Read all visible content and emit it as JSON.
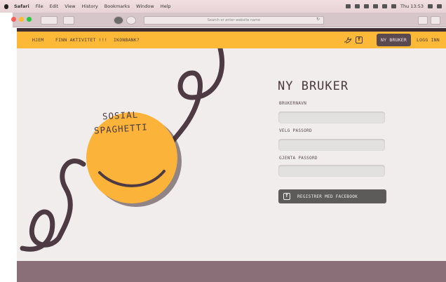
{
  "menubar": {
    "app": "Safari",
    "items": [
      "File",
      "Edit",
      "View",
      "History",
      "Bookmarks",
      "Window",
      "Help"
    ],
    "clock": "Thu 13:53"
  },
  "browser": {
    "url_placeholder": "Search or enter website name"
  },
  "nav": {
    "items": [
      "HJEM",
      "FINN AKTIVITET !!!",
      "IKONBANK?"
    ],
    "bird_icon": "bird-icon",
    "facebook_icon_label": "f",
    "active": "NY BRUKER",
    "login": "LOGG INN"
  },
  "logo": {
    "line1": "SOSIAL",
    "line2": "SPAGHETTI",
    "circle_color": "#fbb33a",
    "noodle_color": "#4d3a42"
  },
  "form": {
    "title": "NY BRUKER",
    "username_label": "BRUKERNAVN",
    "password_label": "VELG PASSORD",
    "password_repeat_label": "GJENTA PASSORD",
    "facebook_button": "REGISTRER MED FACEBOOK",
    "facebook_icon_label": "f"
  },
  "colors": {
    "nav": "#fcb837",
    "accent": "#5a4a50",
    "footer": "#8a6e78",
    "background": "#f2eded"
  }
}
